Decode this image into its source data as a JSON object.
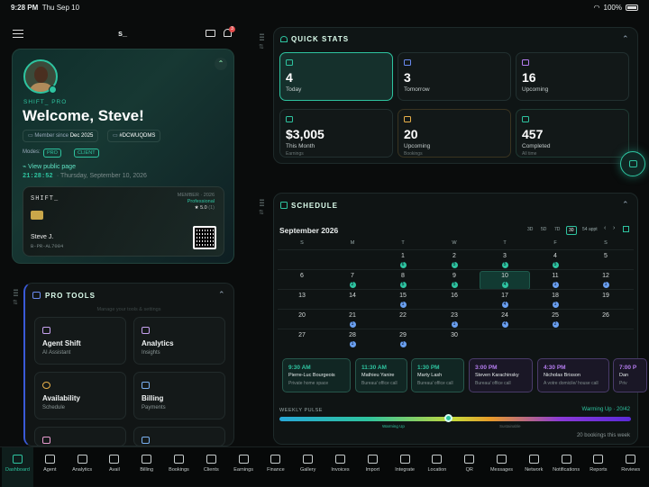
{
  "status": {
    "time": "9:28 PM",
    "date": "Thu Sep 10",
    "battery": "100%"
  },
  "topbar": {
    "logo": "s_",
    "notif_count": "3"
  },
  "profile": {
    "brand": "SHIFT_ PRO",
    "welcome": "Welcome, Steve!",
    "member_since_label": "Member since",
    "member_since": "Dec 2025",
    "id": "#DCWUQDMS",
    "modes_label": "Modes:",
    "modes": [
      "PRO",
      "CLIENT"
    ],
    "view_public": "View public page",
    "clock": "21:28:52",
    "date_text": "· Thursday, September 10, 2026",
    "card": {
      "brand": "SHIFT_",
      "member_label": "MEMBER · 2026",
      "tier": "Professional",
      "rating": "★ 5.0",
      "rating_count": "(1)",
      "name": "Steve J.",
      "card_id": "B-PR-AL7084"
    }
  },
  "protools": {
    "title": "PRO TOOLS",
    "hint": "Manage your tools & settings",
    "tools": [
      {
        "title": "Agent Shift",
        "sub": "AI Assistant",
        "icon": "robot-icon"
      },
      {
        "title": "Analytics",
        "sub": "Insights",
        "icon": "bar-chart-icon"
      },
      {
        "title": "Availability",
        "sub": "Schedule",
        "icon": "clock-icon"
      },
      {
        "title": "Billing",
        "sub": "Payments",
        "icon": "credit-card-icon"
      }
    ]
  },
  "quickstats": {
    "title": "QUICK STATS",
    "stats": [
      {
        "value": "4",
        "label": "Today",
        "sub": "",
        "icon": "calendar-icon"
      },
      {
        "value": "3",
        "label": "Tomorrow",
        "sub": "",
        "icon": "calendar-icon"
      },
      {
        "value": "16",
        "label": "Upcoming",
        "sub": "",
        "icon": "calendar-icon"
      },
      {
        "value": "$3,005",
        "label": "This Month",
        "sub": "Earnings",
        "icon": "dollar-icon"
      },
      {
        "value": "20",
        "label": "Upcoming",
        "sub": "Bookings",
        "icon": "calendar-icon"
      },
      {
        "value": "457",
        "label": "Completed",
        "sub": "All time",
        "icon": "check-circle-icon"
      }
    ]
  },
  "schedule": {
    "title": "SCHEDULE",
    "month": "September 2026",
    "views": [
      "3D",
      "5D",
      "7D",
      "30",
      "54 appt"
    ],
    "weekdays": [
      "S",
      "M",
      "T",
      "W",
      "T",
      "F",
      "S"
    ],
    "weeks": [
      [
        {
          "d": ""
        },
        {
          "d": ""
        },
        {
          "d": "1",
          "n": "6",
          "c": "#2ec4a0"
        },
        {
          "d": "2",
          "n": "5",
          "c": "#2ec4a0"
        },
        {
          "d": "3",
          "n": "5",
          "c": "#2ec4a0"
        },
        {
          "d": "4",
          "n": "5",
          "c": "#2ec4a0"
        },
        {
          "d": "5"
        }
      ],
      [
        {
          "d": "6"
        },
        {
          "d": "7",
          "n": "2",
          "c": "#2ec4a0"
        },
        {
          "d": "8",
          "n": "5",
          "c": "#2ec4a0"
        },
        {
          "d": "9",
          "n": "5",
          "c": "#2ec4a0"
        },
        {
          "d": "10",
          "n": "4",
          "c": "#2ec4a0"
        },
        {
          "d": "11",
          "n": "1",
          "c": "#6aa0f0"
        },
        {
          "d": "12",
          "n": "1",
          "c": "#6aa0f0"
        }
      ],
      [
        {
          "d": "13"
        },
        {
          "d": "14"
        },
        {
          "d": "15",
          "n": "1",
          "c": "#6aa0f0"
        },
        {
          "d": "16"
        },
        {
          "d": "17",
          "n": "4",
          "c": "#6aa0f0"
        },
        {
          "d": "18",
          "n": "1",
          "c": "#6aa0f0"
        },
        {
          "d": "19"
        }
      ],
      [
        {
          "d": "20"
        },
        {
          "d": "21",
          "n": "1",
          "c": "#6aa0f0"
        },
        {
          "d": "22"
        },
        {
          "d": "23",
          "n": "1",
          "c": "#6aa0f0"
        },
        {
          "d": "24",
          "n": "4",
          "c": "#6aa0f0"
        },
        {
          "d": "25",
          "n": "2",
          "c": "#6aa0f0"
        },
        {
          "d": "26"
        }
      ],
      [
        {
          "d": "27"
        },
        {
          "d": "28",
          "n": "1",
          "c": "#6aa0f0"
        },
        {
          "d": "29",
          "n": "2",
          "c": "#6aa0f0"
        },
        {
          "d": "30"
        },
        {
          "d": ""
        },
        {
          "d": ""
        },
        {
          "d": ""
        }
      ]
    ],
    "appointments": [
      {
        "time": "9:30 AM",
        "name": "Pierre-Luc Bourgeois",
        "place": "Private home space",
        "color": "#2ec4a0"
      },
      {
        "time": "11:30 AM",
        "name": "Mathieu Yanire",
        "place": "Bureau/ office call",
        "color": "#2ec4a0"
      },
      {
        "time": "1:30 PM",
        "name": "Marty Lash",
        "place": "Bureau/ office call",
        "color": "#2ec4a0"
      },
      {
        "time": "3:00 PM",
        "name": "Steven Karachinsky",
        "place": "Bureau/ office call",
        "color": "#b57df0"
      },
      {
        "time": "4:30 PM",
        "name": "Nicholas Brisson",
        "place": "A votre domicile/ house call",
        "color": "#b57df0"
      },
      {
        "time": "7:00 P",
        "name": "Dan",
        "place": "Priv",
        "color": "#b57df0"
      }
    ],
    "pulse": {
      "label": "WEEKLY PULSE",
      "status": "Warming Up · 20/42",
      "level": 0.48,
      "left_tag": "Warming Up",
      "mid_tag": "Sustainable",
      "footer": "20 bookings this week"
    }
  },
  "nav": [
    "Dashboard",
    "Agent",
    "Analytics",
    "Avail",
    "Billing",
    "Bookings",
    "Clients",
    "Earnings",
    "Finance",
    "Gallery",
    "Invoices",
    "Import",
    "Integrate",
    "Location",
    "QR",
    "Messages",
    "Network",
    "Notifications",
    "Reports",
    "Reviews"
  ]
}
